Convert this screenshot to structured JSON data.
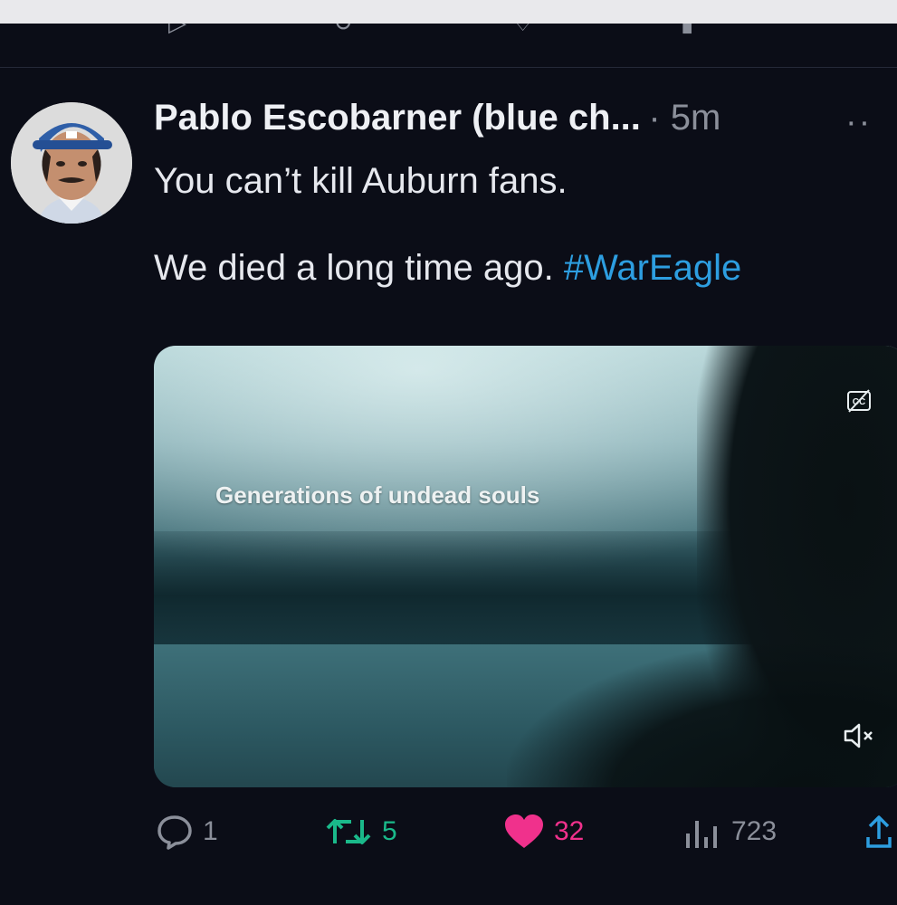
{
  "tweet": {
    "author_name": "Pablo Escobarner (blue ch...",
    "time": "· 5m",
    "text_line1": "You can’t kill Auburn fans.",
    "text_line2_plain": "We died a long time ago. ",
    "hashtag": "#WarEagle"
  },
  "media": {
    "caption": "Generations of undead souls",
    "icons": [
      "closed-captions-icon",
      "muted-speaker-icon"
    ]
  },
  "actions": {
    "replies": "1",
    "reposts": "5",
    "likes": "32",
    "views": "723"
  },
  "colors": {
    "background": "#0b0d17",
    "text": "#e6e8ee",
    "muted": "#8b8f9a",
    "hashtag": "#2d9ee0",
    "like": "#f0318c",
    "repost": "#1ab98a"
  }
}
